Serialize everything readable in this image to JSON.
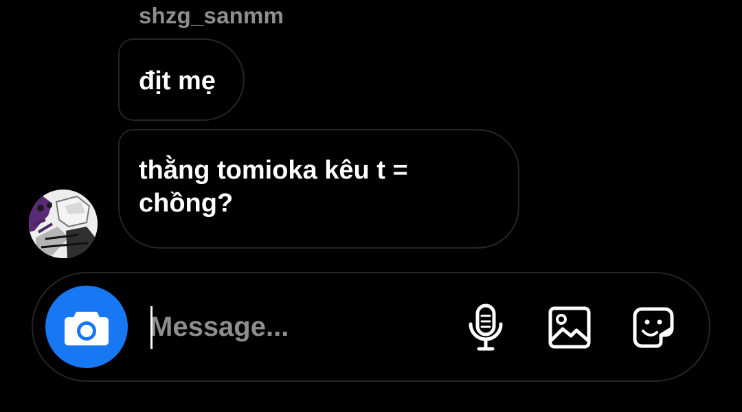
{
  "thread": {
    "sender_username": "shzg_sanmm",
    "messages": [
      {
        "text": "địt mẹ"
      },
      {
        "text": "thằng tomioka kêu t = chồng?"
      }
    ]
  },
  "composer": {
    "placeholder": "Message...",
    "value": "",
    "icons": {
      "camera": "camera-icon",
      "voice": "microphone-icon",
      "media": "gallery-icon",
      "sticker": "sticker-icon"
    }
  },
  "colors": {
    "background": "#000000",
    "bubble_border": "#262626",
    "secondary_text": "#8e8e8e",
    "camera_button": "#1877f2"
  }
}
